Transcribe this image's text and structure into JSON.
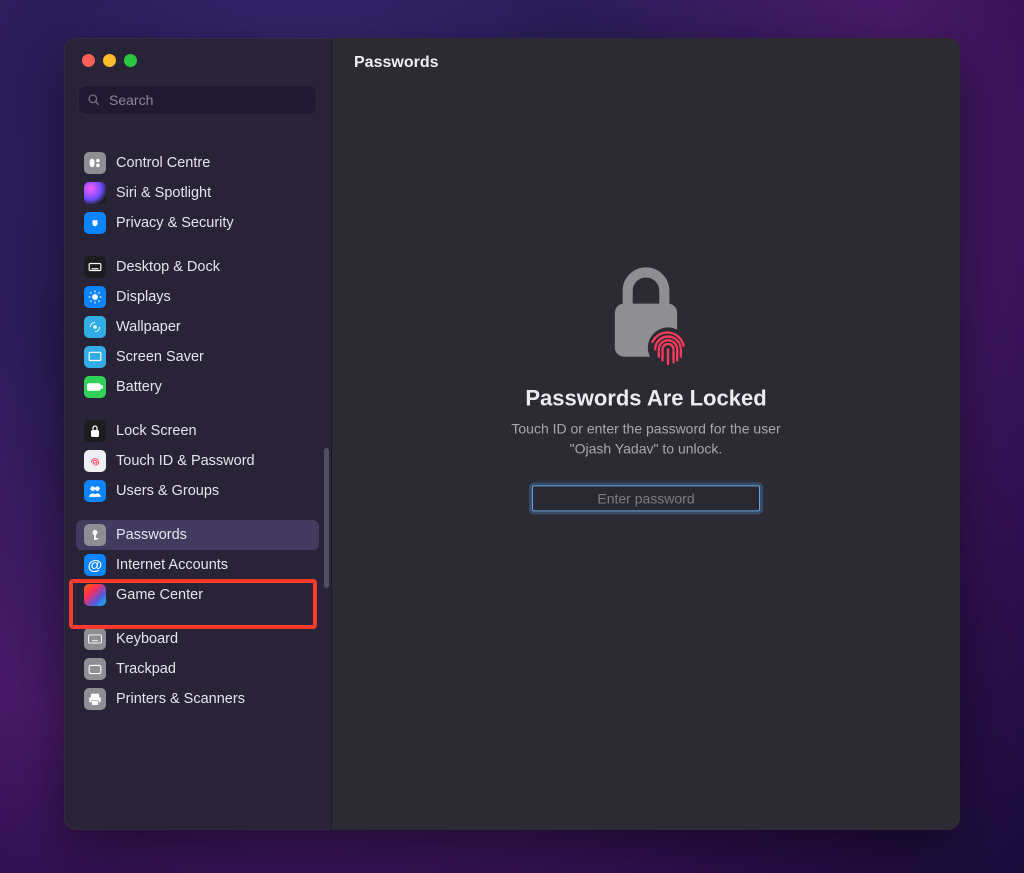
{
  "header": {
    "title": "Passwords"
  },
  "search": {
    "placeholder": "Search"
  },
  "sidebar": {
    "items": [
      {
        "label": "Control Centre"
      },
      {
        "label": "Siri & Spotlight"
      },
      {
        "label": "Privacy & Security"
      },
      {
        "label": "Desktop & Dock"
      },
      {
        "label": "Displays"
      },
      {
        "label": "Wallpaper"
      },
      {
        "label": "Screen Saver"
      },
      {
        "label": "Battery"
      },
      {
        "label": "Lock Screen"
      },
      {
        "label": "Touch ID & Password"
      },
      {
        "label": "Users & Groups"
      },
      {
        "label": "Passwords"
      },
      {
        "label": "Internet Accounts"
      },
      {
        "label": "Game Center"
      },
      {
        "label": "Keyboard"
      },
      {
        "label": "Trackpad"
      },
      {
        "label": "Printers & Scanners"
      }
    ]
  },
  "lock": {
    "title": "Passwords Are Locked",
    "subtitle_prefix": "Touch ID or enter the password for the user",
    "user": "\"Ojash Yadav\"",
    "subtitle_suffix": "to unlock.",
    "placeholder": "Enter password"
  }
}
